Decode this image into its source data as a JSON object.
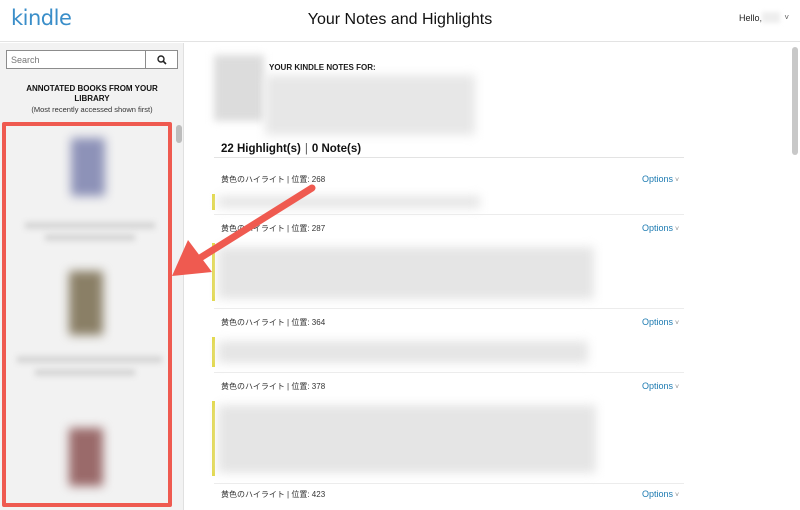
{
  "header": {
    "logo": "kindle",
    "title": "Your Notes and Highlights",
    "greeting": "Hello,",
    "caret": "˅"
  },
  "sidebar": {
    "search_placeholder": "Search",
    "library_title": "ANNOTATED BOOKS FROM YOUR LIBRARY",
    "library_subtitle": "(Most recently accessed shown first)"
  },
  "main": {
    "notes_for_label": "YOUR KINDLE NOTES FOR:",
    "highlight_count": "22 Highlight(s)",
    "separator": "|",
    "note_count": "0 Note(s)",
    "options_label": "Options",
    "options_caret": "˅",
    "highlights": [
      {
        "meta": "黄色のハイライト | 位置: 268"
      },
      {
        "meta": "黄色のハイライト | 位置: 287"
      },
      {
        "meta": "黄色のハイライト | 位置: 364"
      },
      {
        "meta": "黄色のハイライト | 位置: 378"
      },
      {
        "meta": "黄色のハイライト | 位置: 423"
      }
    ]
  },
  "colors": {
    "brand": "#3a8ec9",
    "link": "#1c7ab1",
    "highlight_bar": "#e3d94a",
    "annotation": "#ef5a50"
  }
}
